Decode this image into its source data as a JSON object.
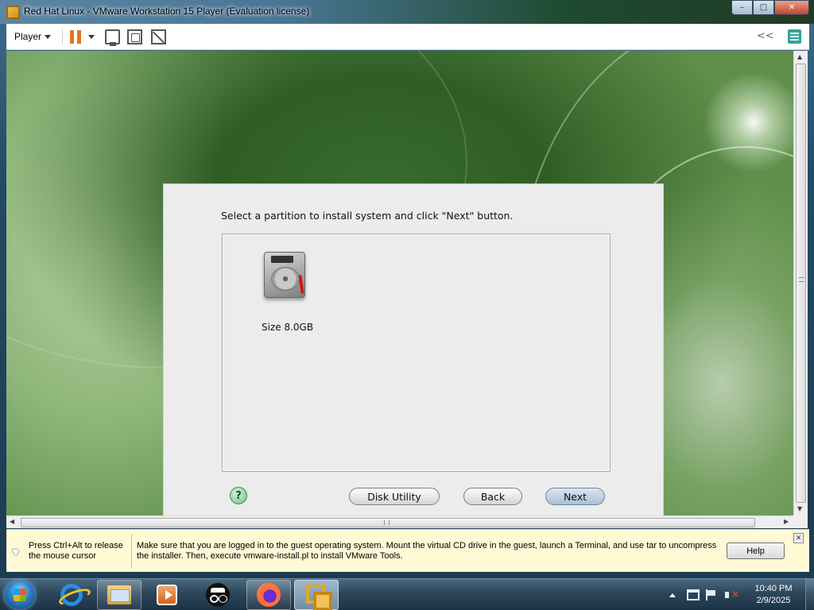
{
  "window": {
    "title": "Red Hat Linux - VMware Workstation 15 Player (Evaluation license)",
    "controls": {
      "minimize": "–",
      "maximize": "□",
      "close": "✕"
    }
  },
  "toolbar": {
    "player_menu": "Player",
    "icons": [
      "pause-icon",
      "send-ctrl-alt-del-icon",
      "fit-guest-icon",
      "unity-icon",
      "collapse-icon",
      "notes-icon"
    ],
    "collapse_glyph": "<<"
  },
  "installer": {
    "instruction": "Select a partition to install system and click \"Next\" button.",
    "partitions": [
      {
        "icon": "hard-disk-icon",
        "label": "Size 8.0GB"
      }
    ],
    "buttons": {
      "help": "?",
      "disk_utility": "Disk Utility",
      "back": "Back",
      "next": "Next"
    }
  },
  "scrollbars": {
    "up": "▲",
    "down": "▼",
    "left": "◀",
    "right": "▶"
  },
  "message_bar": {
    "release_hint": "Press Ctrl+Alt to release the mouse cursor",
    "message": "Make sure that you are logged in to the guest operating system. Mount the virtual CD drive in the guest, launch a Terminal, and use tar to uncompress the installer. Then, execute vmware-install.pl to install VMware Tools.",
    "help_label": "Help",
    "close_glyph": "✕"
  },
  "taskbar": {
    "apps": [
      "internet-explorer",
      "file-explorer",
      "media-player",
      "incognito-app",
      "firefox",
      "vmware-player"
    ],
    "clock_time": "10:40 PM",
    "clock_date": "2/9/2025"
  },
  "colors": {
    "pause_accent": "#e8731c",
    "next_button": "#a9bfd6",
    "message_bar_bg": "#fff9d6"
  }
}
